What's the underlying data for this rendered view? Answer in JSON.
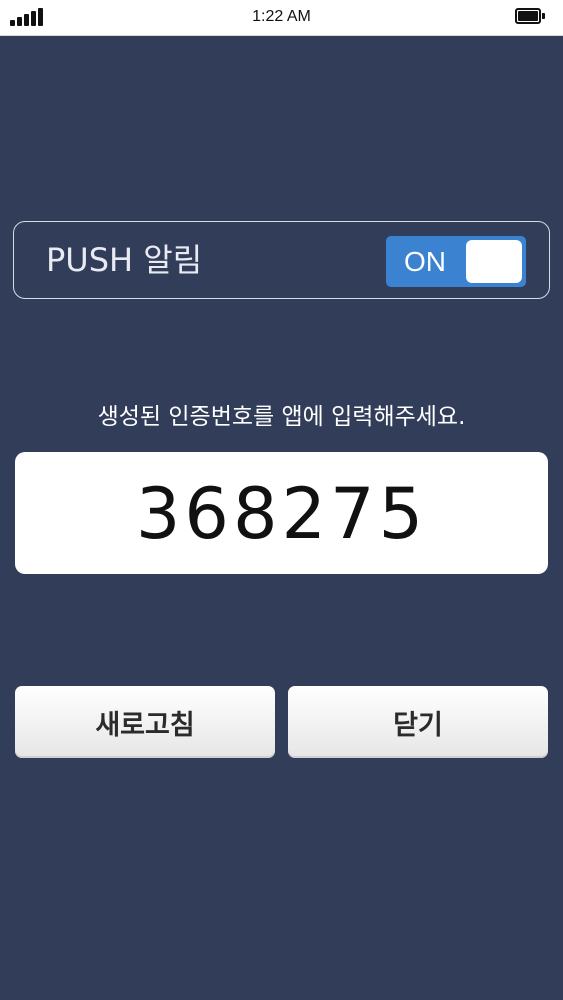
{
  "status_bar": {
    "time": "1:22 AM",
    "signal_icon": "signal-bars-icon",
    "battery_icon": "battery-full-icon"
  },
  "push": {
    "label": "PUSH 알림",
    "toggle_state": "ON",
    "toggle_on": true
  },
  "instruction": "생성된 인증번호를 앱에 입력해주세요.",
  "auth_code": "368275",
  "buttons": {
    "refresh_label": "새로고침",
    "close_label": "닫기"
  },
  "colors": {
    "background": "#323d5a",
    "toggle_accent": "#3b82d1"
  }
}
